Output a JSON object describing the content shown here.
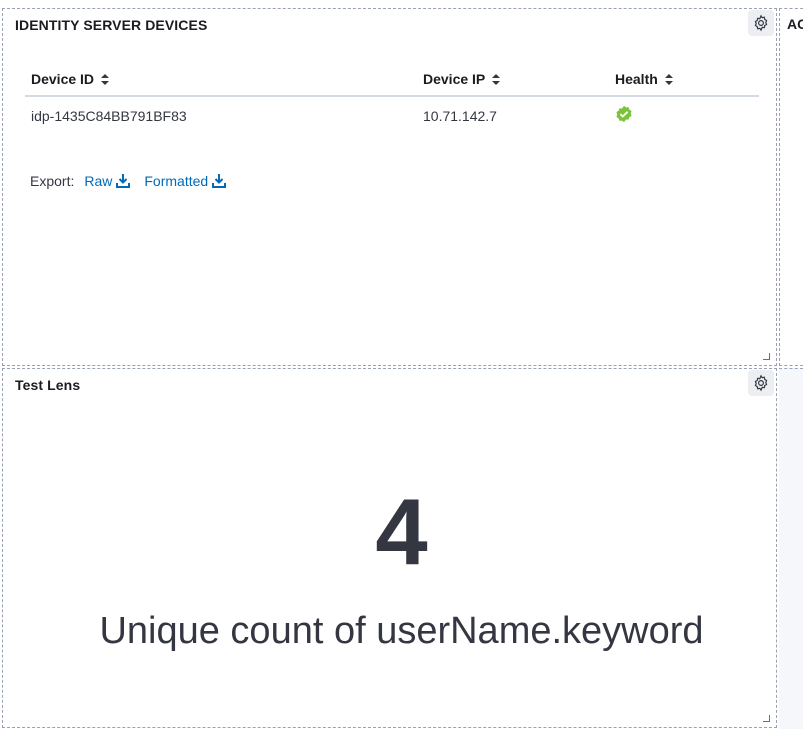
{
  "panels": {
    "devices": {
      "title": "IDENTITY SERVER DEVICES",
      "columns": [
        "Device ID",
        "Device IP",
        "Health"
      ],
      "rows": [
        {
          "device_id": "idp-1435C84BB791BF83",
          "device_ip": "10.71.142.7",
          "health": "healthy"
        }
      ],
      "export": {
        "label": "Export:",
        "raw": "Raw",
        "formatted": "Formatted"
      }
    },
    "lens": {
      "title": "Test Lens",
      "value": "4",
      "label": "Unique count of userName.keyword"
    },
    "next_panel": {
      "title": "AC"
    }
  },
  "colors": {
    "link": "#006bb8",
    "health_ok": "#7dc23b",
    "text": "#343741"
  },
  "icons": {
    "settings": "gear-icon",
    "sort": "sort-icon",
    "download": "download-icon",
    "health": "check-circle-icon"
  }
}
